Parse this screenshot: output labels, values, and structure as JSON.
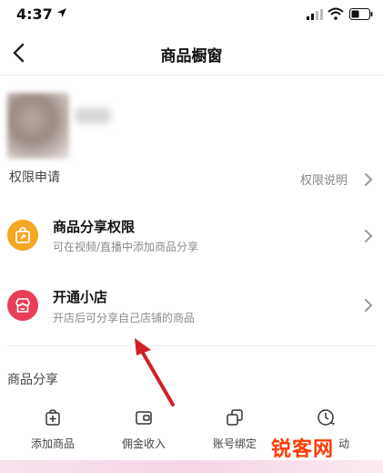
{
  "status_bar": {
    "time": "4:37"
  },
  "nav": {
    "title": "商品橱窗"
  },
  "permission": {
    "title": "权限申请",
    "info_link": "权限说明"
  },
  "rows": [
    {
      "title": "商品分享权限",
      "subtitle": "可在视频/直播中添加商品分享",
      "icon": "shopping-bag-share-icon",
      "icon_color": "#f5a623"
    },
    {
      "title": "开通小店",
      "subtitle": "开店后可分享自己店铺的商品",
      "icon": "store-icon",
      "icon_color": "#e83f57"
    }
  ],
  "share": {
    "title": "商品分享",
    "tools": [
      {
        "label": "添加商品",
        "icon": "add-bag-icon"
      },
      {
        "label": "佣金收入",
        "icon": "wallet-icon"
      },
      {
        "label": "账号绑定",
        "icon": "link-copy-icon"
      },
      {
        "label": "动",
        "icon": "clock-icon"
      }
    ]
  },
  "watermark": "锐客网",
  "colors": {
    "annotation_arrow": "#d0202a"
  }
}
